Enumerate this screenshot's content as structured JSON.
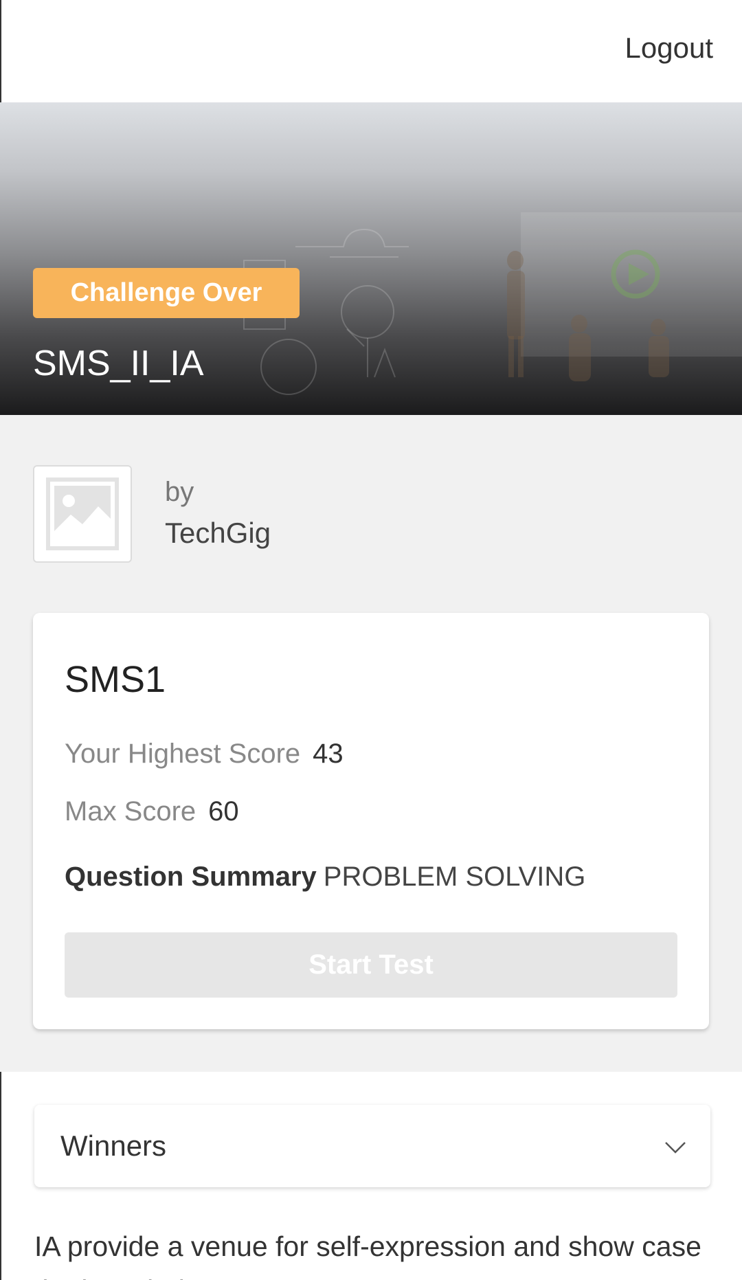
{
  "header": {
    "logout_label": "Logout"
  },
  "hero": {
    "badge": "Challenge Over",
    "title": "SMS_II_IA"
  },
  "organizer": {
    "by_label": "by",
    "name": "TechGig",
    "logo_icon": "image-placeholder-icon"
  },
  "test_card": {
    "title": "SMS1",
    "highest_score_label": "Your Highest Score",
    "highest_score_value": "43",
    "max_score_label": "Max Score",
    "max_score_value": "60",
    "summary_label": "Question Summary",
    "summary_value": "PROBLEM SOLVING",
    "start_button": "Start Test"
  },
  "winners": {
    "label": "Winners",
    "icon": "chevron-down-icon"
  },
  "description": "IA provide a venue for self-expression and show case the knowledge",
  "colors": {
    "badge": "#f8b45a",
    "button_disabled": "#e6e6e6",
    "background": "#f1f1f1"
  }
}
